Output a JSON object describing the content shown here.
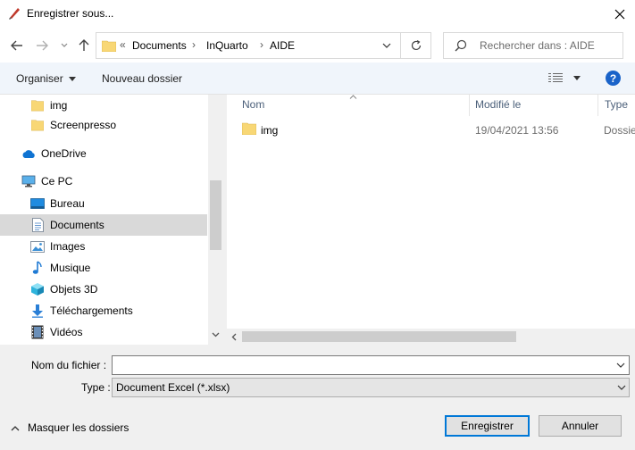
{
  "window": {
    "title": "Enregistrer sous..."
  },
  "address": {
    "overflow": "«",
    "crumbs": [
      "Documents",
      "InQuarto",
      "AIDE"
    ],
    "separator": "›"
  },
  "search": {
    "placeholder": "Rechercher dans : AIDE"
  },
  "toolbar": {
    "organize": "Organiser",
    "new_folder": "Nouveau dossier"
  },
  "sidebar": {
    "items": [
      {
        "label": "img",
        "icon": "folder-icon"
      },
      {
        "label": "Screenpresso",
        "icon": "folder-icon"
      },
      {
        "label": "OneDrive",
        "icon": "cloud-icon"
      },
      {
        "label": "Ce PC",
        "icon": "computer-icon"
      },
      {
        "label": "Bureau",
        "icon": "desktop-icon"
      },
      {
        "label": "Documents",
        "icon": "documents-icon",
        "selected": true
      },
      {
        "label": "Images",
        "icon": "pictures-icon"
      },
      {
        "label": "Musique",
        "icon": "music-icon"
      },
      {
        "label": "Objets 3D",
        "icon": "3d-objects-icon"
      },
      {
        "label": "Téléchargements",
        "icon": "downloads-icon"
      },
      {
        "label": "Vidéos",
        "icon": "videos-icon"
      }
    ]
  },
  "files": {
    "columns": [
      "Nom",
      "Modifié le",
      "Type"
    ],
    "rows": [
      {
        "name": "img",
        "modified": "19/04/2021 13:56",
        "type": "Dossie"
      }
    ]
  },
  "form": {
    "filename_label": "Nom du fichier :",
    "filename_value": "",
    "type_label": "Type :",
    "type_value": "Document Excel (*.xlsx)"
  },
  "footer": {
    "hide_folders": "Masquer les dossiers",
    "save": "Enregistrer",
    "cancel": "Annuler"
  },
  "colors": {
    "accent": "#0078d7",
    "folder": "#f8d775",
    "help": "#1a63c9",
    "selection": "#d9d9d9"
  }
}
